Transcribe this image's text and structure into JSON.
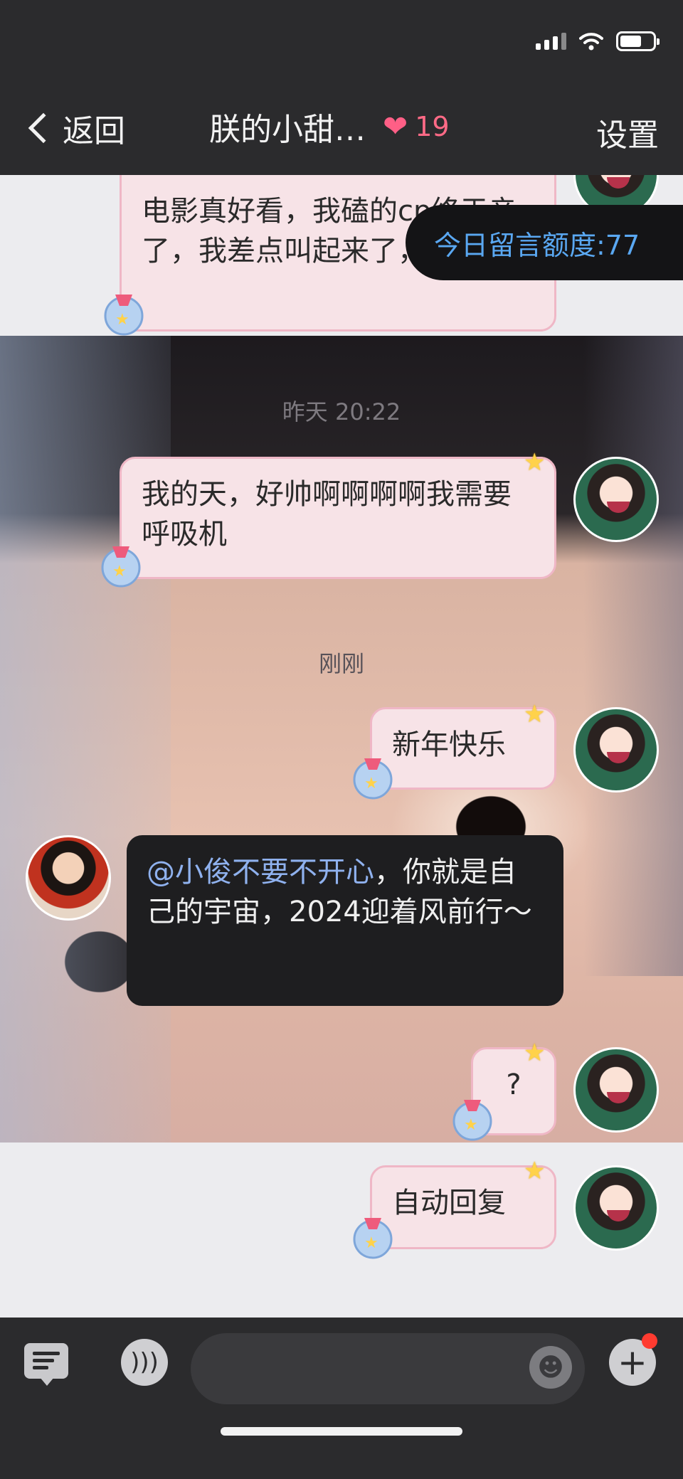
{
  "status_bar": {
    "battery_level": 0.65
  },
  "nav": {
    "back_label": "返回",
    "title": "朕的小甜…",
    "heart_count": "19",
    "settings_label": "设置"
  },
  "quota_banner": "今日留言额度:77",
  "messages": [
    {
      "side": "right",
      "text": "电影真好看，我磕的cp终于亲了，我差点叫起来了，好激动"
    },
    {
      "timestamp": "昨天 20:22"
    },
    {
      "side": "right",
      "text": "我的天，好帅啊啊啊啊我需要呼吸机"
    },
    {
      "timestamp": "刚刚"
    },
    {
      "side": "right",
      "text": "新年快乐"
    },
    {
      "side": "left",
      "mention": "@小俊不要不开心",
      "text": "，你就是自己的宇宙，2024迎着风前行～"
    },
    {
      "side": "right",
      "text": "?"
    },
    {
      "side": "right",
      "text": "自动回复"
    }
  ],
  "colors": {
    "accent_blue": "#5aa8f2",
    "bubble_pink": "#f7e3e7",
    "heart_pink": "#ff5f86",
    "notification_red": "#ff3b30"
  },
  "icons": [
    "wifi-icon",
    "signal-icon",
    "battery-icon",
    "back-chevron-icon",
    "heart-icon",
    "keyboard-icon",
    "voice-icon",
    "emoji-icon",
    "plus-icon"
  ]
}
